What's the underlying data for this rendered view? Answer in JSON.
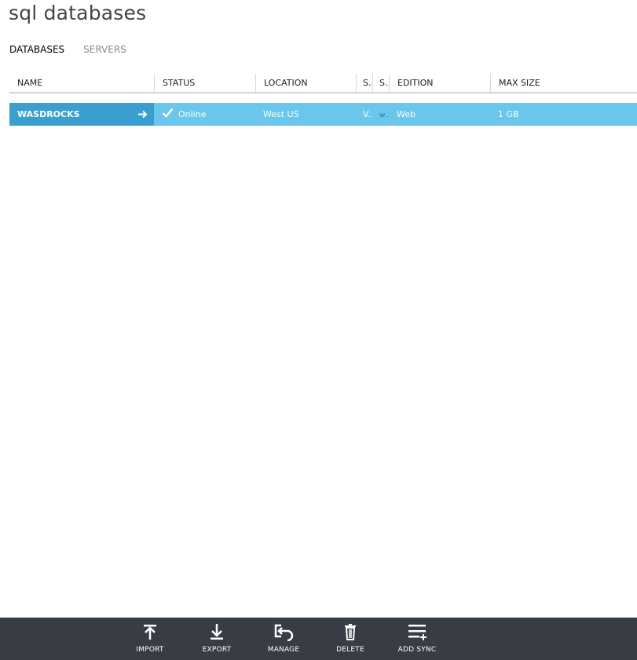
{
  "page": {
    "title": "sql databases"
  },
  "tabs": [
    {
      "label": "DATABASES",
      "active": true
    },
    {
      "label": "SERVERS",
      "active": false
    }
  ],
  "table": {
    "columns": [
      "NAME",
      "STATUS",
      "LOCATION",
      "S..",
      "S..",
      "EDITION",
      "MAX SIZE"
    ],
    "rows": [
      {
        "name": "WASDROCKS",
        "status": "Online",
        "location": "West US",
        "col4": "V..",
        "col5": "w..",
        "edition": "Web",
        "max_size": "1 GB"
      }
    ]
  },
  "commands": [
    {
      "label": "IMPORT",
      "icon": "import-icon"
    },
    {
      "label": "EXPORT",
      "icon": "export-icon"
    },
    {
      "label": "MANAGE",
      "icon": "manage-icon"
    },
    {
      "label": "DELETE",
      "icon": "delete-icon"
    },
    {
      "label": "ADD SYNC",
      "icon": "add-sync-icon"
    }
  ],
  "colors": {
    "row_selected": "#6ac6ea",
    "name_cell": "#3a9fcf",
    "command_bar": "#383d45"
  }
}
